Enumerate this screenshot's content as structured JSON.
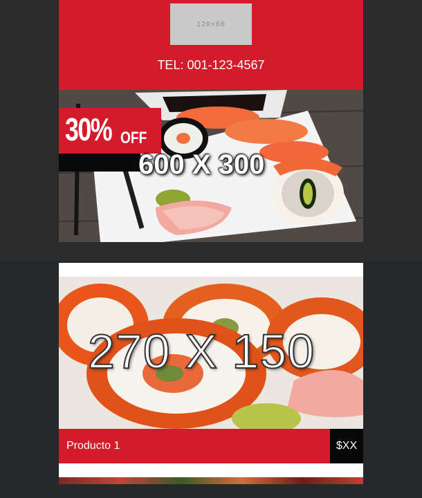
{
  "header": {
    "logo_placeholder": "120×60",
    "phone": "TEL: 001-123-4567"
  },
  "hero": {
    "promo_percent": "30%",
    "promo_off": "OFF",
    "image_placeholder": "600 X 300"
  },
  "products": [
    {
      "image_placeholder": "270 X 150",
      "name": "Producto 1",
      "price": "$XX"
    }
  ],
  "colors": {
    "brand_red": "#d41b2c",
    "price_bg": "#070707",
    "page_bg": "#2b2b2b"
  }
}
